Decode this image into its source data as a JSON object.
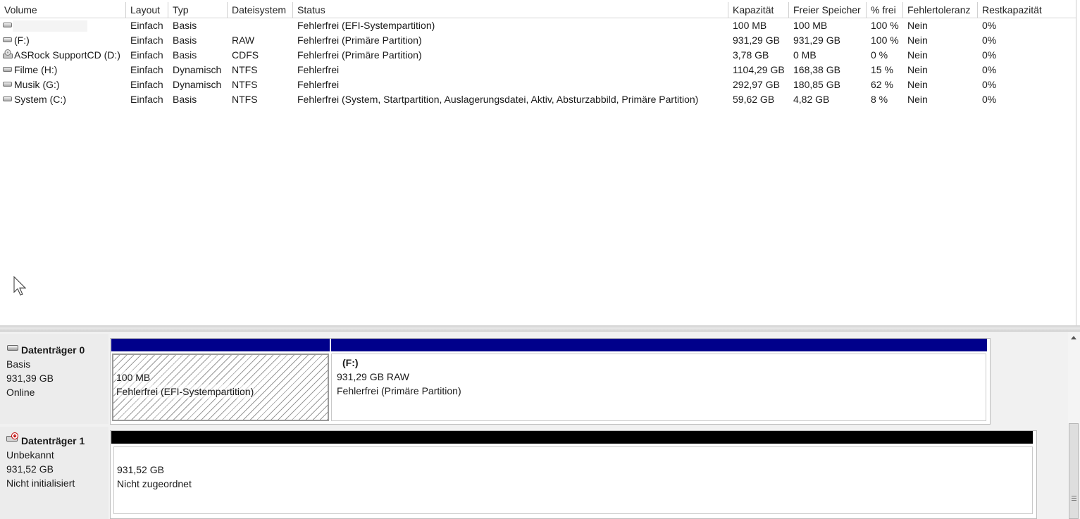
{
  "columns": [
    "Volume",
    "Layout",
    "Typ",
    "Dateisystem",
    "Status",
    "Kapazität",
    "Freier Speicher",
    "% frei",
    "Fehlertoleranz",
    "Restkapazität"
  ],
  "volumes": [
    {
      "icon": "drive-icon",
      "name": "",
      "layout": "Einfach",
      "typ": "Basis",
      "fs": "",
      "status": "Fehlerfrei (EFI-Systempartition)",
      "kap": "100 MB",
      "frei": "100 MB",
      "pct": "100 %",
      "ft": "Nein",
      "rest": "0%"
    },
    {
      "icon": "drive-icon",
      "name": " (F:)",
      "layout": "Einfach",
      "typ": "Basis",
      "fs": "RAW",
      "status": "Fehlerfrei (Primäre Partition)",
      "kap": "931,29 GB",
      "frei": "931,29 GB",
      "pct": "100 %",
      "ft": "Nein",
      "rest": "0%"
    },
    {
      "icon": "cd-drive-icon",
      "name": "ASRock SupportCD (D:)",
      "layout": "Einfach",
      "typ": "Basis",
      "fs": "CDFS",
      "status": "Fehlerfrei (Primäre Partition)",
      "kap": "3,78 GB",
      "frei": "0 MB",
      "pct": "0 %",
      "ft": "Nein",
      "rest": "0%"
    },
    {
      "icon": "drive-icon",
      "name": "Filme (H:)",
      "layout": "Einfach",
      "typ": "Dynamisch",
      "fs": "NTFS",
      "status": "Fehlerfrei",
      "kap": "1104,29 GB",
      "frei": "168,38 GB",
      "pct": "15 %",
      "ft": "Nein",
      "rest": "0%"
    },
    {
      "icon": "drive-icon",
      "name": "Musik (G:)",
      "layout": "Einfach",
      "typ": "Dynamisch",
      "fs": "NTFS",
      "status": "Fehlerfrei",
      "kap": "292,97 GB",
      "frei": "180,85 GB",
      "pct": "62 %",
      "ft": "Nein",
      "rest": "0%"
    },
    {
      "icon": "drive-icon",
      "name": "System (C:)",
      "layout": "Einfach",
      "typ": "Basis",
      "fs": "NTFS",
      "status": "Fehlerfrei (System, Startpartition, Auslagerungsdatei, Aktiv, Absturzabbild, Primäre Partition)",
      "kap": "59,62 GB",
      "frei": "4,82 GB",
      "pct": "8 %",
      "ft": "Nein",
      "rest": "0%"
    }
  ],
  "disk0": {
    "name": "Datenträger 0",
    "type": "Basis",
    "size": "931,39 GB",
    "state": "Online",
    "part1": {
      "size": "100 MB",
      "status": "Fehlerfrei (EFI-Systempartition)"
    },
    "part2": {
      "name": "(F:)",
      "size": "931,29 GB RAW",
      "status": "Fehlerfrei (Primäre Partition)"
    },
    "header_color": "#00008b"
  },
  "disk1": {
    "name": "Datenträger 1",
    "type": "Unbekannt",
    "size": "931,52 GB",
    "state": "Nicht initialisiert",
    "part1": {
      "size": "931,52 GB",
      "status": "Nicht zugeordnet"
    },
    "header_color": "#000000"
  }
}
